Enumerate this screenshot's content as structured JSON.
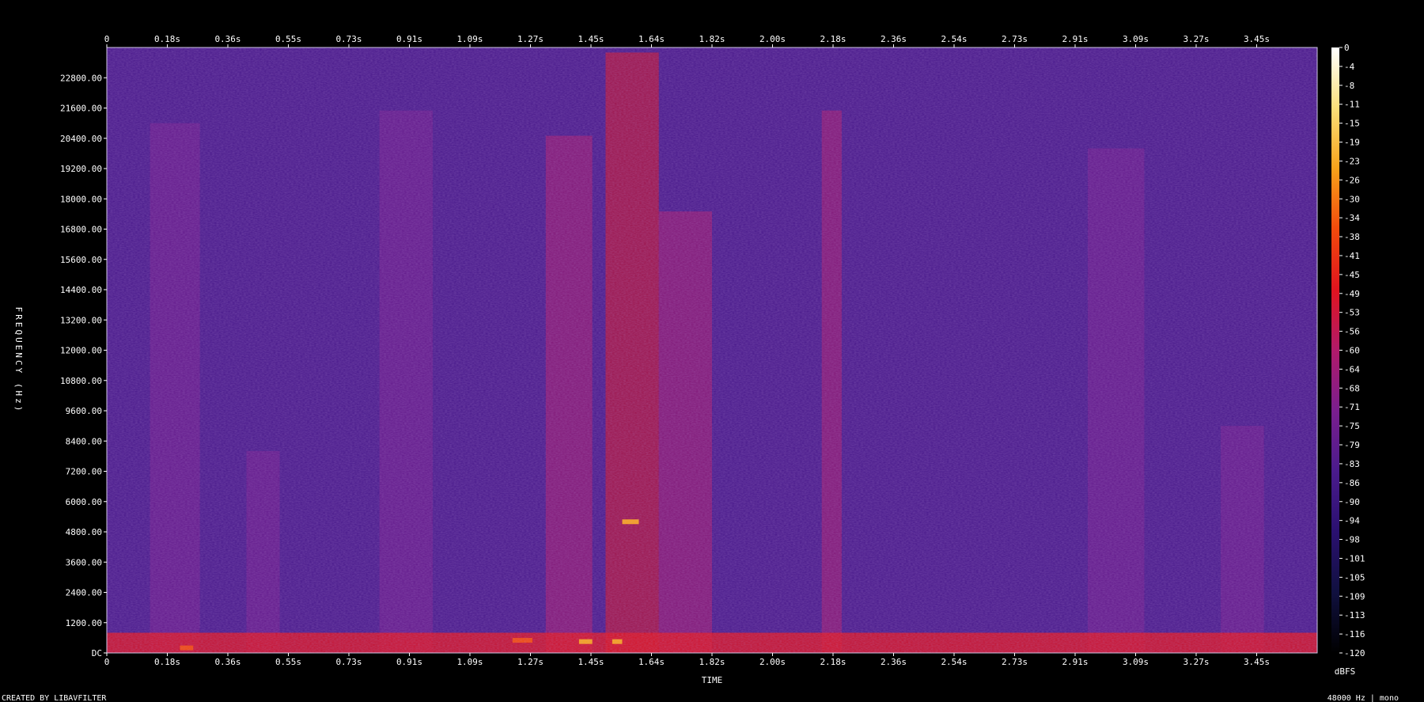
{
  "chart_data": {
    "type": "heatmap",
    "title": "",
    "xlabel": "TIME",
    "ylabel": "FREQUENCY (Hz)",
    "xlim": [
      0,
      3.64
    ],
    "ylim": [
      0,
      24000
    ],
    "x_ticks": [
      {
        "value": 0,
        "label": "0"
      },
      {
        "value": 0.182,
        "label": "0.18s"
      },
      {
        "value": 0.364,
        "label": "0.36s"
      },
      {
        "value": 0.546,
        "label": "0.55s"
      },
      {
        "value": 0.728,
        "label": "0.73s"
      },
      {
        "value": 0.91,
        "label": "0.91s"
      },
      {
        "value": 1.092,
        "label": "1.09s"
      },
      {
        "value": 1.274,
        "label": "1.27s"
      },
      {
        "value": 1.456,
        "label": "1.45s"
      },
      {
        "value": 1.638,
        "label": "1.64s"
      },
      {
        "value": 1.82,
        "label": "1.82s"
      },
      {
        "value": 2.002,
        "label": "2.00s"
      },
      {
        "value": 2.184,
        "label": "2.18s"
      },
      {
        "value": 2.366,
        "label": "2.36s"
      },
      {
        "value": 2.548,
        "label": "2.54s"
      },
      {
        "value": 2.73,
        "label": "2.73s"
      },
      {
        "value": 2.912,
        "label": "2.91s"
      },
      {
        "value": 3.094,
        "label": "3.09s"
      },
      {
        "value": 3.276,
        "label": "3.27s"
      },
      {
        "value": 3.458,
        "label": "3.45s"
      }
    ],
    "y_ticks": [
      {
        "value": 0,
        "label": "DC"
      },
      {
        "value": 1200,
        "label": "1200.00"
      },
      {
        "value": 2400,
        "label": "2400.00"
      },
      {
        "value": 3600,
        "label": "3600.00"
      },
      {
        "value": 4800,
        "label": "4800.00"
      },
      {
        "value": 6000,
        "label": "6000.00"
      },
      {
        "value": 7200,
        "label": "7200.00"
      },
      {
        "value": 8400,
        "label": "8400.00"
      },
      {
        "value": 9600,
        "label": "9600.00"
      },
      {
        "value": 10800,
        "label": "10800.00"
      },
      {
        "value": 12000,
        "label": "12000.00"
      },
      {
        "value": 13200,
        "label": "13200.00"
      },
      {
        "value": 14400,
        "label": "14400.00"
      },
      {
        "value": 15600,
        "label": "15600.00"
      },
      {
        "value": 16800,
        "label": "16800.00"
      },
      {
        "value": 18000,
        "label": "18000.00"
      },
      {
        "value": 19200,
        "label": "19200.00"
      },
      {
        "value": 20400,
        "label": "20400.00"
      },
      {
        "value": 21600,
        "label": "21600.00"
      },
      {
        "value": 22800,
        "label": "22800.00"
      }
    ],
    "colorbar": {
      "unit": "dBFS",
      "range": [
        -120,
        0
      ],
      "ticks": [
        "0",
        "-4",
        "-8",
        "-11",
        "-15",
        "-19",
        "-23",
        "-26",
        "-30",
        "-34",
        "-38",
        "-41",
        "-45",
        "-49",
        "-53",
        "-56",
        "-60",
        "-64",
        "-68",
        "-71",
        "-75",
        "-79",
        "-83",
        "-86",
        "-90",
        "-94",
        "-98",
        "-101",
        "-105",
        "-109",
        "-113",
        "-116",
        "-120"
      ],
      "colors": [
        "#000000",
        "#10103f",
        "#2a1070",
        "#4a1b8c",
        "#7a1e8e",
        "#b01a6a",
        "#e0141e",
        "#f24a0c",
        "#f8a21a",
        "#fbe07a",
        "#ffffff"
      ]
    },
    "grid": false,
    "background_db": -88,
    "events": [
      {
        "start": 0.13,
        "end": 0.28,
        "fmax": 21000,
        "peak_db": -68
      },
      {
        "start": 0.42,
        "end": 0.52,
        "fmax": 8000,
        "peak_db": -72
      },
      {
        "start": 0.82,
        "end": 0.98,
        "fmax": 21500,
        "peak_db": -68
      },
      {
        "start": 1.32,
        "end": 1.46,
        "fmax": 20500,
        "peak_db": -62
      },
      {
        "start": 1.5,
        "end": 1.66,
        "fmax": 23800,
        "peak_db": -48
      },
      {
        "start": 1.66,
        "end": 1.82,
        "fmax": 17500,
        "peak_db": -64
      },
      {
        "start": 2.15,
        "end": 2.21,
        "fmax": 21500,
        "peak_db": -58
      },
      {
        "start": 2.95,
        "end": 3.12,
        "fmax": 20000,
        "peak_db": -68
      },
      {
        "start": 3.35,
        "end": 3.48,
        "fmax": 9000,
        "peak_db": -72
      }
    ],
    "tones": [
      {
        "time_start": 1.55,
        "time_end": 1.6,
        "freq": 5200,
        "peak_db": -30
      },
      {
        "time_start": 1.22,
        "time_end": 1.28,
        "freq": 500,
        "peak_db": -34
      },
      {
        "time_start": 1.42,
        "time_end": 1.46,
        "freq": 450,
        "peak_db": -30
      },
      {
        "time_start": 1.52,
        "time_end": 1.55,
        "freq": 450,
        "peak_db": -30
      },
      {
        "time_start": 0.22,
        "time_end": 0.26,
        "freq": 200,
        "peak_db": -34
      }
    ]
  },
  "footer": {
    "credit": "CREATED BY LIBAVFILTER",
    "info": "48000 Hz | mono"
  }
}
